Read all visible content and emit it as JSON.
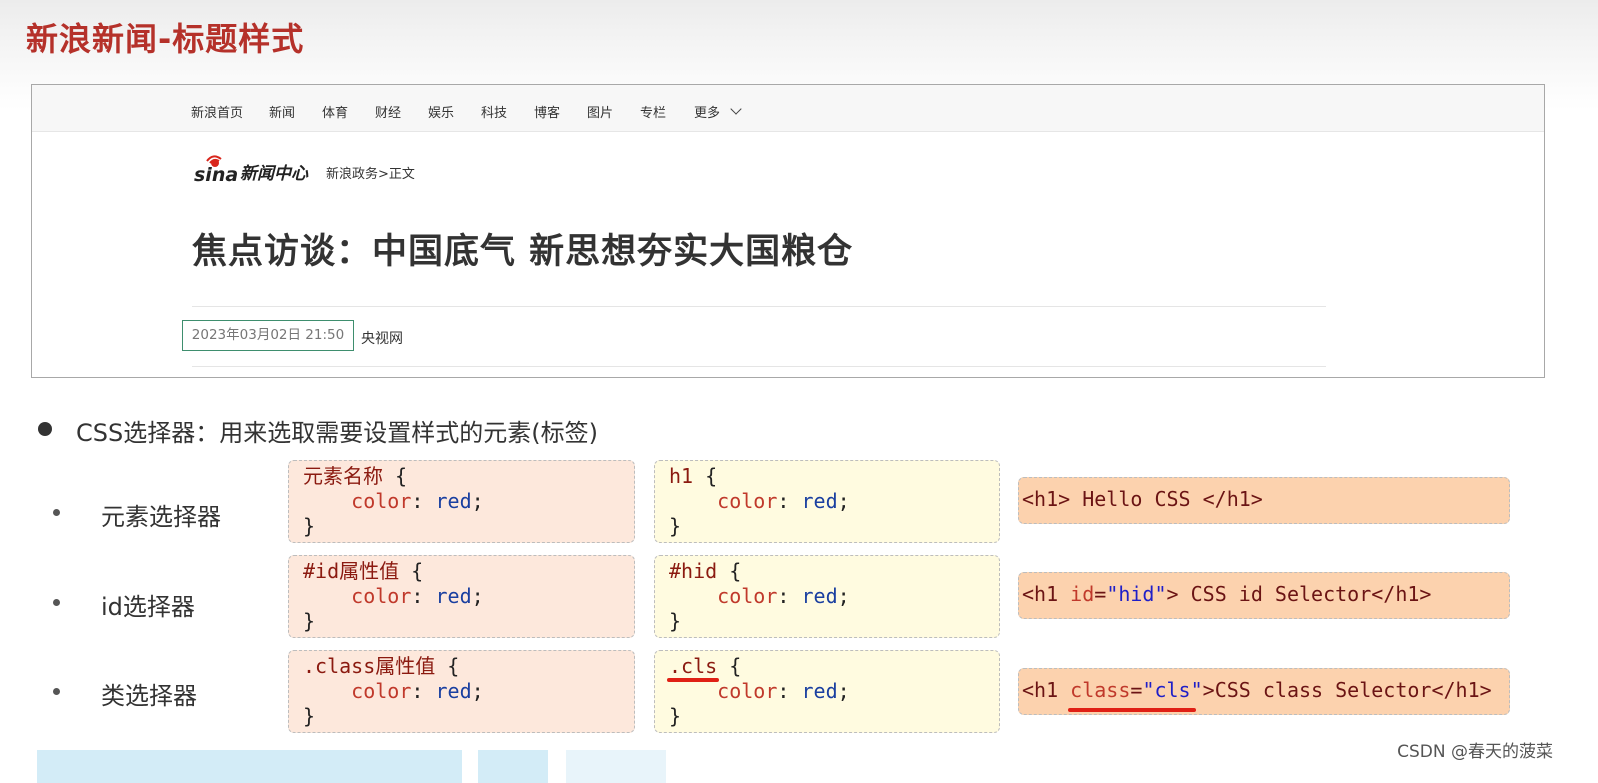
{
  "slide": {
    "title": "新浪新闻-标题样式"
  },
  "browser": {
    "nav": [
      "新浪首页",
      "新闻",
      "体育",
      "财经",
      "娱乐",
      "科技",
      "博客",
      "图片",
      "专栏",
      "更多"
    ],
    "logo_text": "新闻中心",
    "breadcrumb": {
      "section": "新浪政务",
      "sep": ">",
      "current": "正文"
    },
    "headline": "焦点访谈：中国底气 新思想夯实大国粮仓",
    "date": "2023年03月02日 21:50",
    "source": "央视网"
  },
  "intro": "CSS选择器：用来选取需要设置样式的元素(标签)",
  "rows": [
    {
      "label": "元素选择器",
      "syntax": {
        "selector": "元素名称",
        "brace_open": " {",
        "prop": "color",
        "colon": ": ",
        "value": "red",
        "semi": ";",
        "brace_close": "}"
      },
      "example": {
        "selector": "h1",
        "brace_open": " {",
        "prop": "color",
        "colon": ": ",
        "value": "red",
        "semi": ";",
        "brace_close": "}"
      },
      "html": {
        "open": "<h1>",
        "text": " Hello CSS ",
        "close": "</h1>"
      }
    },
    {
      "label": "id选择器",
      "syntax": {
        "selector": "#id属性值",
        "brace_open": " {",
        "prop": "color",
        "colon": ": ",
        "value": "red",
        "semi": ";",
        "brace_close": "}"
      },
      "example": {
        "selector": "#hid",
        "brace_open": " {",
        "prop": "color",
        "colon": ": ",
        "value": "red",
        "semi": ";",
        "brace_close": "}"
      },
      "html": {
        "tag_start": "<h1 ",
        "attr": "id",
        "eq": "=",
        "value": "\"hid\"",
        "gt": ">",
        "text": " CSS id Selector",
        "close": "</h1>"
      }
    },
    {
      "label": "类选择器",
      "syntax": {
        "selector": ".class属性值",
        "brace_open": " {",
        "prop": "color",
        "colon": ": ",
        "value": "red",
        "semi": ";",
        "brace_close": "}"
      },
      "example": {
        "selector": ".cls",
        "brace_open": " {",
        "prop": "color",
        "colon": ": ",
        "value": "red",
        "semi": ";",
        "brace_close": "}"
      },
      "html": {
        "tag_start": "<h1 ",
        "attr": "class",
        "eq": "=",
        "value": "\"cls\"",
        "gt": ">",
        "text": "CSS class Selector",
        "close": "</h1>"
      }
    }
  ],
  "watermark": "CSDN @春天的菠菜",
  "colors": {
    "title": "#b5312a",
    "syntax_bg": "#fde8dc",
    "example_bg": "#fffbe0",
    "html_bg": "#fcd2ae",
    "underline": "#e02015"
  }
}
